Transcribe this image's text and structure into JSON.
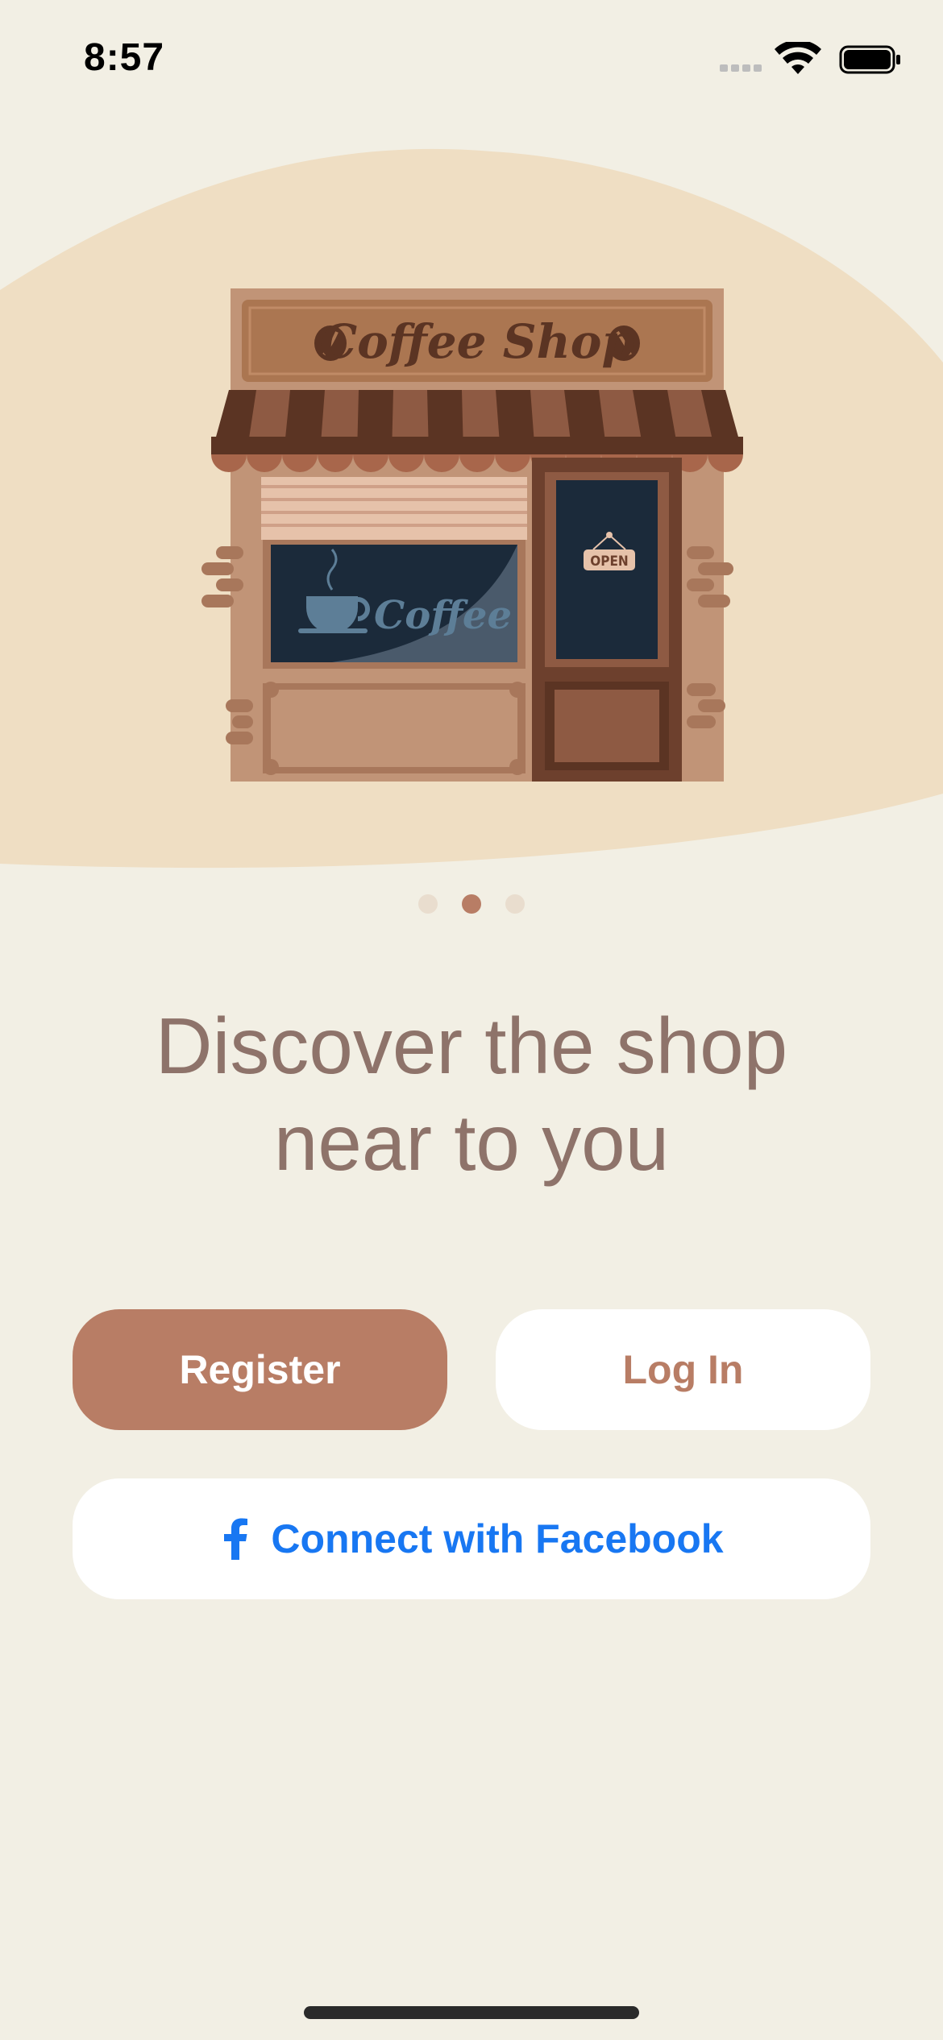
{
  "status_bar": {
    "time": "8:57",
    "icons": [
      "signal-dots-icon",
      "wifi-icon",
      "battery-icon"
    ]
  },
  "illustration": {
    "sign_text": "Coffee Shop",
    "window_text": "Coffee",
    "door_sign_text": "OPEN"
  },
  "pager": {
    "count": 3,
    "active_index": 1
  },
  "headline": {
    "line1": "Discover the shop",
    "line2": "near to you"
  },
  "buttons": {
    "register_label": "Register",
    "login_label": "Log In",
    "facebook_label": "Connect with Facebook",
    "facebook_icon": "facebook-f-icon"
  },
  "colors": {
    "background": "#F2EFE4",
    "blob": "#EFDEC3",
    "accent": "#B87D65",
    "headline": "#8E736A",
    "facebook_blue": "#1877F2",
    "dot_inactive": "#E9DDCE"
  }
}
